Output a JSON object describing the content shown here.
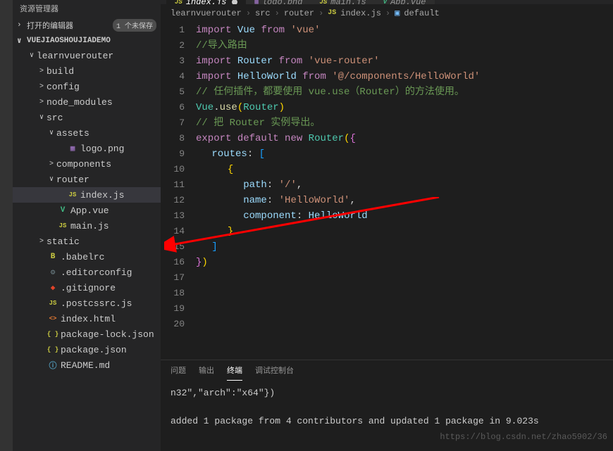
{
  "sidebar": {
    "title": "资源管理器",
    "openEditors": "打开的编辑器",
    "unsaved": "1 个未保存",
    "projectName": "VUEJIAOSHOUJIADEMO",
    "tree": [
      {
        "level": 1,
        "chev": "∨",
        "icon": "",
        "name": "learnvuerouter",
        "type": "folder"
      },
      {
        "level": 2,
        "chev": ">",
        "icon": "",
        "name": "build",
        "type": "folder"
      },
      {
        "level": 2,
        "chev": ">",
        "icon": "",
        "name": "config",
        "type": "folder"
      },
      {
        "level": 2,
        "chev": ">",
        "icon": "",
        "name": "node_modules",
        "type": "folder"
      },
      {
        "level": 2,
        "chev": "∨",
        "icon": "",
        "name": "src",
        "type": "folder"
      },
      {
        "level": 3,
        "chev": "∨",
        "icon": "",
        "name": "assets",
        "type": "folder"
      },
      {
        "level": 4,
        "chev": "",
        "icon": "▦",
        "name": "logo.png",
        "type": "png"
      },
      {
        "level": 3,
        "chev": ">",
        "icon": "",
        "name": "components",
        "type": "folder"
      },
      {
        "level": 3,
        "chev": "∨",
        "icon": "",
        "name": "router",
        "type": "folder"
      },
      {
        "level": 4,
        "chev": "",
        "icon": "JS",
        "name": "index.js",
        "type": "js",
        "selected": true
      },
      {
        "level": 3,
        "chev": "",
        "icon": "V",
        "name": "App.vue",
        "type": "vue"
      },
      {
        "level": 3,
        "chev": "",
        "icon": "JS",
        "name": "main.js",
        "type": "js"
      },
      {
        "level": 2,
        "chev": ">",
        "icon": "",
        "name": "static",
        "type": "folder"
      },
      {
        "level": 2,
        "chev": "",
        "icon": "B",
        "name": ".babelrc",
        "type": "babel"
      },
      {
        "level": 2,
        "chev": "",
        "icon": "⚙",
        "name": ".editorconfig",
        "type": "gear"
      },
      {
        "level": 2,
        "chev": "",
        "icon": "◆",
        "name": ".gitignore",
        "type": "git"
      },
      {
        "level": 2,
        "chev": "",
        "icon": "JS",
        "name": ".postcssrc.js",
        "type": "js"
      },
      {
        "level": 2,
        "chev": "",
        "icon": "<>",
        "name": "index.html",
        "type": "html"
      },
      {
        "level": 2,
        "chev": "",
        "icon": "{ }",
        "name": "package-lock.json",
        "type": "json"
      },
      {
        "level": 2,
        "chev": "",
        "icon": "{ }",
        "name": "package.json",
        "type": "json"
      },
      {
        "level": 2,
        "chev": "",
        "icon": "ⓘ",
        "name": "README.md",
        "type": "md"
      }
    ]
  },
  "tabs": [
    {
      "icon": "JS",
      "name": "index.js",
      "active": true,
      "modified": true,
      "iconClass": "file-js"
    },
    {
      "icon": "▦",
      "name": "logo.png",
      "active": false,
      "iconClass": "file-png"
    },
    {
      "icon": "JS",
      "name": "main.js",
      "active": false,
      "iconClass": "file-js"
    },
    {
      "icon": "V",
      "name": "App.vue",
      "active": false,
      "iconClass": "file-vue"
    }
  ],
  "breadcrumb": {
    "items": [
      "learnvuerouter",
      "src",
      "router",
      "index.js",
      "default"
    ]
  },
  "code": {
    "lines": [
      {
        "n": 1,
        "html": "<span class='kw'>import</span> <span class='var'>Vue</span> <span class='kw'>from</span> <span class='str'>'vue'</span>"
      },
      {
        "n": 2,
        "html": ""
      },
      {
        "n": 3,
        "html": "<span class='cmt'>//导入路由</span>"
      },
      {
        "n": 4,
        "html": "<span class='kw'>import</span> <span class='var'>Router</span> <span class='kw'>from</span> <span class='str'>'vue-router'</span>"
      },
      {
        "n": 5,
        "html": "<span class='kw'>import</span> <span class='var'>HelloWorld</span> <span class='kw'>from</span> <span class='str'>'@/components/HelloWorld'</span>"
      },
      {
        "n": 6,
        "html": ""
      },
      {
        "n": 7,
        "html": "<span class='cmt'>// 任何插件，都要使用 vue.use（Router）的方法使用。</span>"
      },
      {
        "n": 8,
        "html": "<span class='cls'>Vue</span><span class='punc'>.</span><span class='fn'>use</span><span class='yellow-brace'>(</span><span class='cls'>Router</span><span class='yellow-brace'>)</span>"
      },
      {
        "n": 9,
        "html": ""
      },
      {
        "n": 10,
        "html": ""
      },
      {
        "n": 11,
        "html": "<span class='cmt'>// 把 Router 实例导出。</span>"
      },
      {
        "n": 12,
        "html": "<span class='kw'>export</span> <span class='kw'>default</span> <span class='kw'>new</span> <span class='cls'>Router</span><span class='yellow-brace'>(</span><span class='purple-brace'>{</span>"
      },
      {
        "n": 13,
        "html": "<span class='pipe'>·</span> <span class='var'>routes</span><span class='punc'>:</span> <span class='blue-brace'>[</span>"
      },
      {
        "n": 14,
        "html": "<span class='pipe'>·</span> <span class='pipe'>·</span> <span class='yellow-brace'>{</span>"
      },
      {
        "n": 15,
        "html": "<span class='pipe'>·</span> <span class='pipe'>·</span> <span class='pipe'>·</span> <span class='var'>path</span><span class='punc'>:</span> <span class='str'>'/'</span><span class='punc'>,</span>"
      },
      {
        "n": 16,
        "html": "<span class='pipe'>·</span> <span class='pipe'>·</span> <span class='pipe'>·</span> <span class='var'>name</span><span class='punc'>:</span> <span class='str'>'HelloWorld'</span><span class='punc'>,</span>"
      },
      {
        "n": 17,
        "html": "<span class='pipe'>·</span> <span class='pipe'>·</span> <span class='pipe'>·</span> <span class='var'>component</span><span class='punc'>:</span> <span class='var'>HelloWorld</span>"
      },
      {
        "n": 18,
        "html": "<span class='pipe'>·</span> <span class='pipe'>·</span> <span class='yellow-brace'>}</span>"
      },
      {
        "n": 19,
        "html": "<span class='pipe'>·</span> <span class='blue-brace'>]</span>"
      },
      {
        "n": 20,
        "html": "<span class='purple-brace'>}</span><span class='yellow-brace'>)</span>"
      }
    ]
  },
  "terminal": {
    "tabs": [
      "问题",
      "输出",
      "终端",
      "调试控制台"
    ],
    "activeTab": 2,
    "line1": "n32\",\"arch\":\"x64\"})",
    "line2": "added 1 package from 4 contributors and updated 1 package in 9.023s"
  },
  "watermark": "https://blog.csdn.net/zhao5902/36"
}
